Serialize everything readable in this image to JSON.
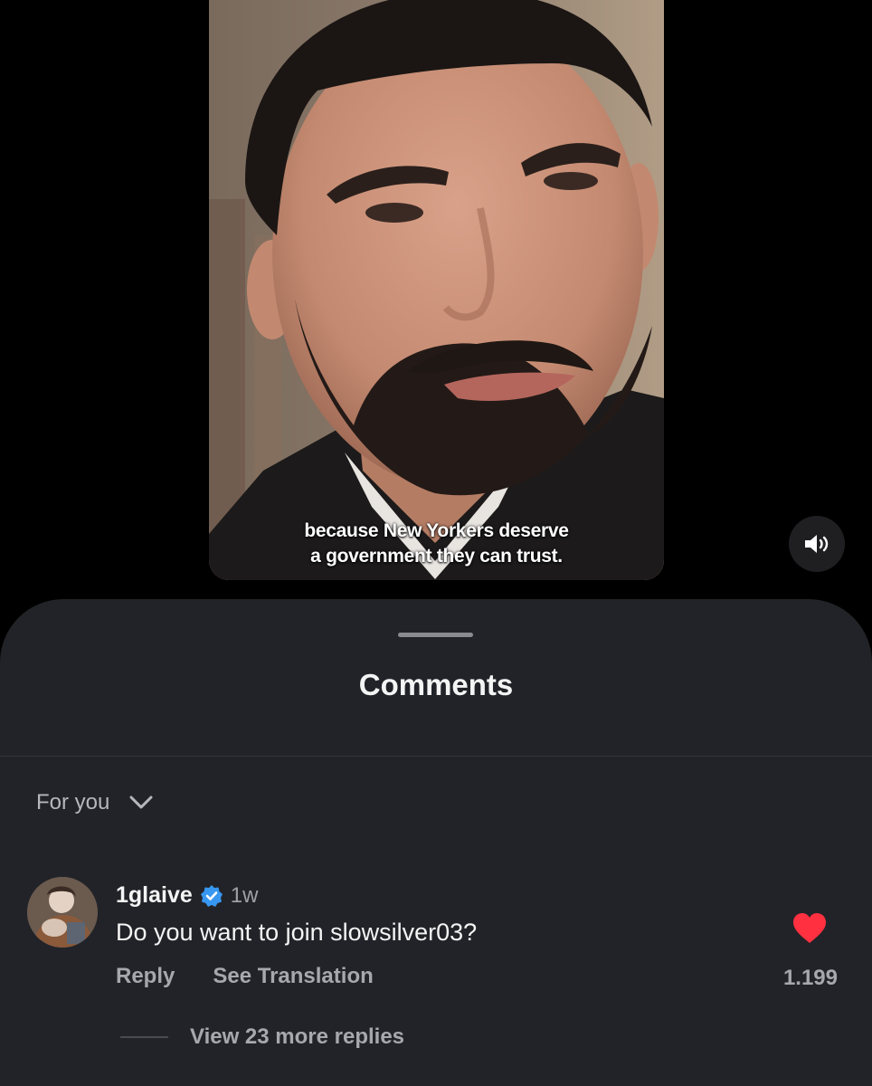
{
  "video": {
    "caption_line1": "because New Yorkers deserve",
    "caption_line2": "a government they can trust."
  },
  "sound_button": {
    "icon": "speaker-volume-icon"
  },
  "comments_sheet": {
    "title": "Comments",
    "sort_label": "For you",
    "comments": [
      {
        "username": "1glaive",
        "verified": true,
        "time": "1w",
        "text": "Do you want to join slowsilver03?",
        "reply_label": "Reply",
        "translate_label": "See Translation",
        "like_count": "1.199",
        "liked": true,
        "view_replies_label": "View 23 more replies"
      }
    ]
  },
  "colors": {
    "sheet_background": "#222328",
    "verified_badge": "#3897f0",
    "like_heart": "#ff3040"
  }
}
